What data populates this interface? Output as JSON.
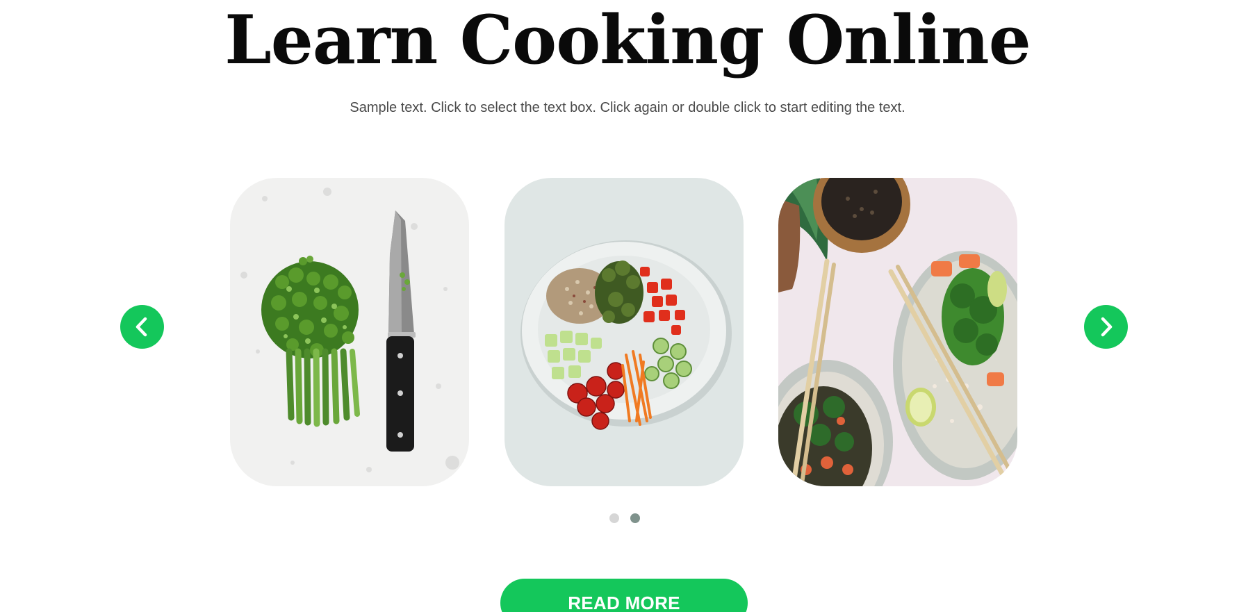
{
  "hero": {
    "title": "Learn Cooking Online",
    "subtitle": "Sample text. Click to select the text box. Click again or double click to start editing the text."
  },
  "carousel": {
    "prev_icon": "chevron-left-icon",
    "next_icon": "chevron-right-icon",
    "slides": [
      {
        "image": "chopped-green-onions-and-knife-photo"
      },
      {
        "image": "vegetable-and-quinoa-bowl-photo"
      },
      {
        "image": "salad-bowls-with-chopsticks-photo"
      }
    ],
    "indicator": {
      "count": 2,
      "active": 2
    }
  },
  "cta": {
    "read_more_label": "READ MORE"
  },
  "colors": {
    "accent": "#14c75b",
    "dot_inactive": "#d6d6d6",
    "dot_active": "#7f928c",
    "title": "#0a0a0a",
    "body_text": "#4a4a4a"
  }
}
